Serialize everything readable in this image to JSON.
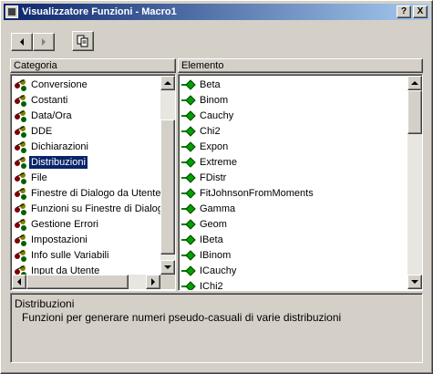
{
  "window": {
    "title": "Visualizzatore Funzioni - Macro1"
  },
  "titlebar_buttons": {
    "help_label": "?",
    "close_label": "X"
  },
  "left_pane": {
    "header": "Categoria",
    "items": [
      {
        "label": "Conversione"
      },
      {
        "label": "Costanti"
      },
      {
        "label": "Data/Ora"
      },
      {
        "label": "DDE"
      },
      {
        "label": "Dichiarazioni"
      },
      {
        "label": "Distribuzioni",
        "selected": true
      },
      {
        "label": "File"
      },
      {
        "label": "Finestre di Dialogo da Utente"
      },
      {
        "label": "Funzioni su Finestre di Dialogo"
      },
      {
        "label": "Gestione Errori"
      },
      {
        "label": "Impostazioni"
      },
      {
        "label": "Info sulle Variabili"
      },
      {
        "label": "Input da Utente"
      }
    ]
  },
  "right_pane": {
    "header": "Elemento",
    "items": [
      {
        "label": "Beta"
      },
      {
        "label": "Binom"
      },
      {
        "label": "Cauchy"
      },
      {
        "label": "Chi2"
      },
      {
        "label": "Expon"
      },
      {
        "label": "Extreme"
      },
      {
        "label": "FDistr"
      },
      {
        "label": "FitJohnsonFromMoments"
      },
      {
        "label": "Gamma"
      },
      {
        "label": "Geom"
      },
      {
        "label": "IBeta"
      },
      {
        "label": "IBinom"
      },
      {
        "label": "ICauchy"
      },
      {
        "label": "IChi2"
      }
    ]
  },
  "description": {
    "title": "Distribuzioni",
    "text": "Funzioni per generare numeri pseudo-casuali di varie distribuzioni"
  },
  "colors": {
    "selection": "#0a246a",
    "titlebar": "#0a246a",
    "face": "#d4d0c8"
  },
  "icons": {
    "category": "category-icon",
    "function": "function-icon"
  }
}
